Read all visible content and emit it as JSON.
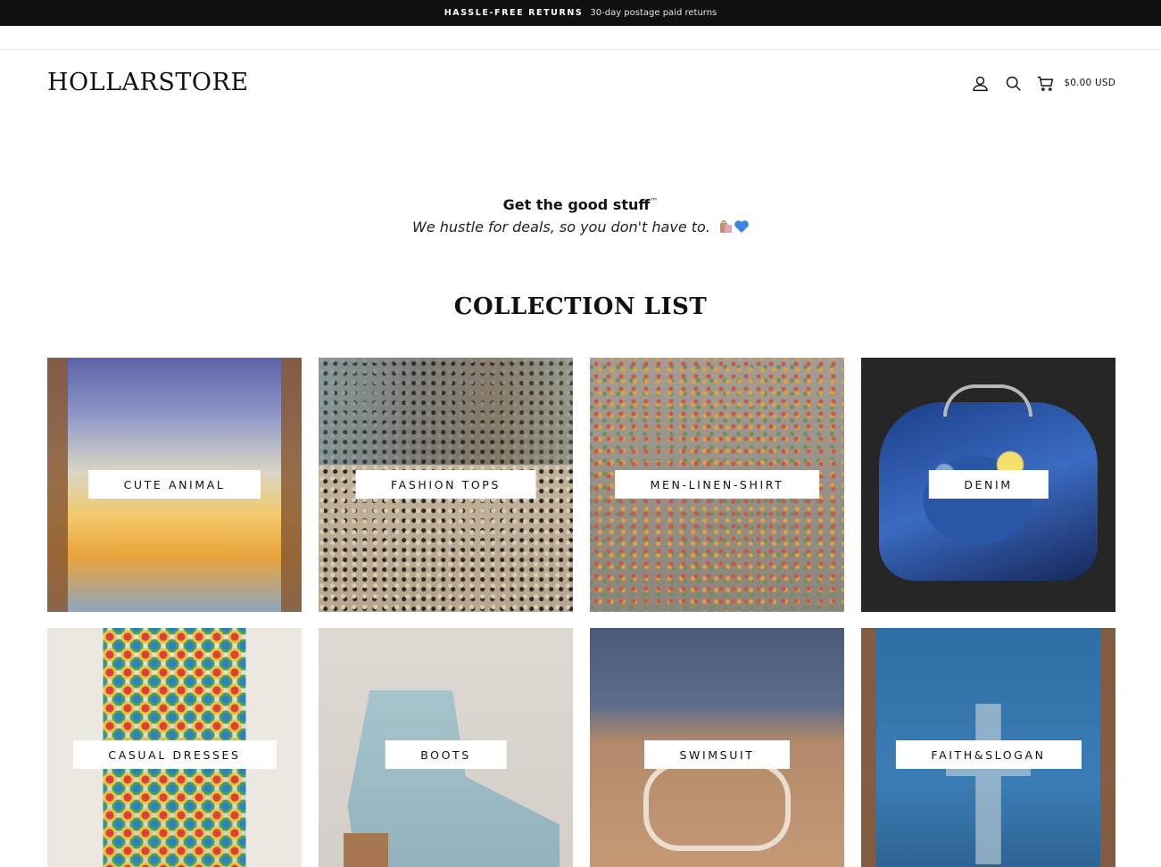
{
  "announcement": {
    "strong": "HASSLE-FREE RETURNS",
    "detail": "30-day postage paid returns"
  },
  "header": {
    "logo": "HOLLARSTORE",
    "icons": [
      "user-icon",
      "search-icon",
      "cart-icon"
    ],
    "cart_total": "$0.00 USD"
  },
  "intro": {
    "headline": "Get the good stuff",
    "trademark": "™",
    "tagline": "We hustle for deals, so you don't have to."
  },
  "collection": {
    "title": "COLLECTION LIST",
    "items": [
      {
        "label": "CUTE ANIMAL"
      },
      {
        "label": "FASHION TOPS"
      },
      {
        "label": "MEN-LINEN-SHIRT"
      },
      {
        "label": "DENIM"
      },
      {
        "label": "CASUAL DRESSES"
      },
      {
        "label": "BOOTS"
      },
      {
        "label": "SWIMSUIT"
      },
      {
        "label": "FAITH&SLOGAN"
      }
    ]
  },
  "colors": {
    "announcement_bg": "#0f0f0f",
    "text": "#111111",
    "background": "#ffffff"
  }
}
